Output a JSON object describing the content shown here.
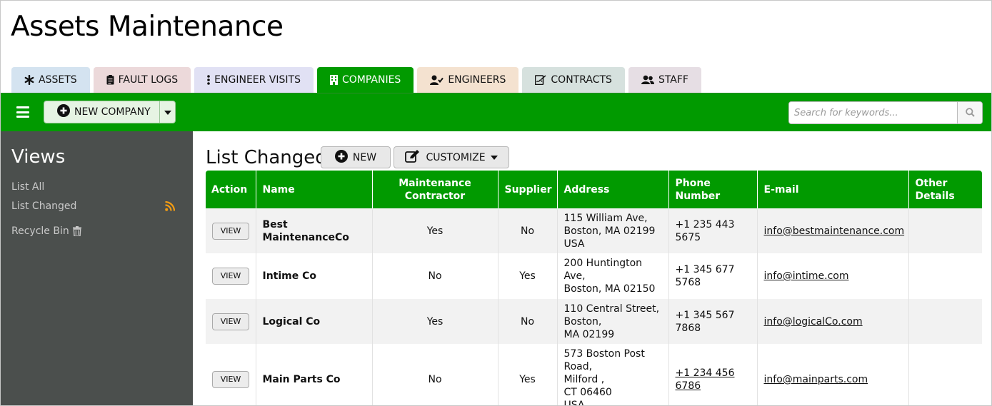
{
  "app": {
    "title": "Assets Maintenance"
  },
  "colors": {
    "green": "#019a00",
    "sidebar": "#4b4f4d",
    "rss": "#f39c12"
  },
  "tabs": [
    {
      "label": "ASSETS",
      "icon": "asterisk-icon",
      "bg": "#d4e3f0",
      "active": false
    },
    {
      "label": "FAULT LOGS",
      "icon": "clipboard-icon",
      "bg": "#ecd9da",
      "active": false
    },
    {
      "label": "ENGINEER VISITS",
      "icon": "vertical-ellipsis-icon",
      "bg": "#e1e1f4",
      "active": false
    },
    {
      "label": "COMPANIES",
      "icon": "building-icon",
      "bg": "#019a00",
      "active": true
    },
    {
      "label": "ENGINEERS",
      "icon": "user-check-icon",
      "bg": "#f4e2d0",
      "active": false
    },
    {
      "label": "CONTRACTS",
      "icon": "signature-icon",
      "bg": "#d6e1de",
      "active": false
    },
    {
      "label": "STAFF",
      "icon": "users-icon",
      "bg": "#e6dee4",
      "active": false
    }
  ],
  "toolbar": {
    "new_company_label": "NEW COMPANY"
  },
  "search": {
    "placeholder": "Search for keywords..."
  },
  "sidebar": {
    "title": "Views",
    "links": {
      "list_all": "List All",
      "list_changed": "List Changed",
      "recycle_bin": "Recycle Bin"
    }
  },
  "main": {
    "title": "List Changed",
    "new_label": "NEW",
    "customize_label": "CUSTOMIZE"
  },
  "table": {
    "columns": [
      "Action",
      "Name",
      "Maintenance Contractor",
      "Supplier",
      "Address",
      "Phone Number",
      "E-mail",
      "Other Details"
    ],
    "rows": [
      {
        "action": "VIEW",
        "name": "Best MaintenanceCo",
        "maintenance_contractor": "Yes",
        "supplier": "No",
        "address": [
          "115 William Ave,",
          "Boston, MA 02199",
          "USA"
        ],
        "phone": "+1 235 443 5675",
        "email": "info@bestmaintenance.com",
        "other_details": ""
      },
      {
        "action": "VIEW",
        "name": "Intime Co",
        "maintenance_contractor": "No",
        "supplier": "Yes",
        "address": [
          "200 Huntington Ave,",
          "Boston, MA 02150"
        ],
        "phone": "+1 345 677 5768",
        "email": "info@intime.com",
        "other_details": ""
      },
      {
        "action": "VIEW",
        "name": "Logical Co",
        "maintenance_contractor": "Yes",
        "supplier": "No",
        "address": [
          "110 Central Street,",
          "Boston,",
          "MA 02199"
        ],
        "phone": "+1 345 567 7868",
        "email": "info@logicalCo.com",
        "other_details": ""
      },
      {
        "action": "VIEW",
        "name": "Main Parts Co",
        "maintenance_contractor": "No",
        "supplier": "Yes",
        "address": [
          "573 Boston Post Road,",
          "Milford ,",
          "CT 06460",
          "USA"
        ],
        "phone": "+1 234 456 6786",
        "email": "info@mainparts.com",
        "other_details": ""
      }
    ]
  }
}
